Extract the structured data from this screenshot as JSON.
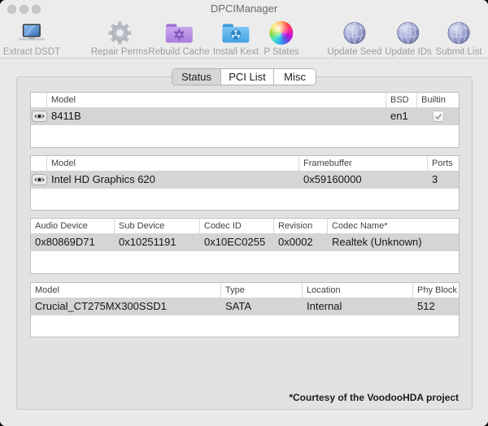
{
  "window": {
    "title": "DPCIManager"
  },
  "toolbar": {
    "items": [
      {
        "label": "Extract DSDT",
        "icon": "laptop-icon"
      },
      {
        "label": "Repair Perms",
        "icon": "gear-icon"
      },
      {
        "label": "Rebuild Cache",
        "icon": "purple-folder-gear-icon"
      },
      {
        "label": "Install Kext",
        "icon": "blue-folder-kext-icon"
      },
      {
        "label": "P States",
        "icon": "color-wheel-icon"
      },
      {
        "label": "Update Seed",
        "icon": "globe-icon"
      },
      {
        "label": "Update IDs",
        "icon": "globe-icon"
      },
      {
        "label": "Submit List",
        "icon": "globe-icon"
      }
    ]
  },
  "tabs": {
    "status": "Status",
    "pci_list": "PCI List",
    "misc": "Misc",
    "selected": "Status"
  },
  "network_table": {
    "headers": {
      "model": "Model",
      "bsd": "BSD",
      "builtin": "Builtin"
    },
    "row": {
      "model": "8411B",
      "bsd": "en1",
      "builtin_checked": true
    }
  },
  "graphics_table": {
    "headers": {
      "model": "Model",
      "framebuffer": "Framebuffer",
      "ports": "Ports"
    },
    "row": {
      "model": "Intel HD Graphics 620",
      "framebuffer": "0x59160000",
      "ports": "3"
    }
  },
  "audio_table": {
    "headers": [
      "Audio Device",
      "Sub Device",
      "Codec ID",
      "Revision",
      "Codec Name*"
    ],
    "row": [
      "0x80869D71",
      "0x10251191",
      "0x10EC0255",
      "0x0002",
      "Realtek (Unknown)"
    ]
  },
  "storage_table": {
    "headers": [
      "Model",
      "Type",
      "Location",
      "Phy Block"
    ],
    "row": [
      "Crucial_CT275MX300SSD1",
      "SATA",
      "Internal",
      "512"
    ]
  },
  "footer": {
    "note": "*Courtesy of the VoodooHDA project"
  },
  "colors": {
    "window_bg": "#ebebeb",
    "panel_bg": "#e2e2e2",
    "selected_row": "#d5d5d5",
    "selected_segment": "#d6d6d6",
    "folder_purple": "#b48ae0",
    "folder_blue": "#56aeea",
    "globe_purple": "#8d93c8"
  }
}
